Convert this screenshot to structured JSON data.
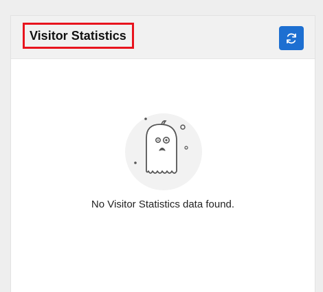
{
  "widget": {
    "title": "Visitor Statistics",
    "refresh_icon": "refresh-icon",
    "empty_icon": "ghost-icon",
    "empty_message": "No Visitor Statistics data found."
  },
  "colors": {
    "page_background": "#eeeeee",
    "header_background": "#f1f1f1",
    "title_highlight_border": "#e8131d",
    "refresh_button": "#1d6fd1",
    "illustration_circle": "#f2f2f2",
    "illustration_stroke": "#555555"
  }
}
